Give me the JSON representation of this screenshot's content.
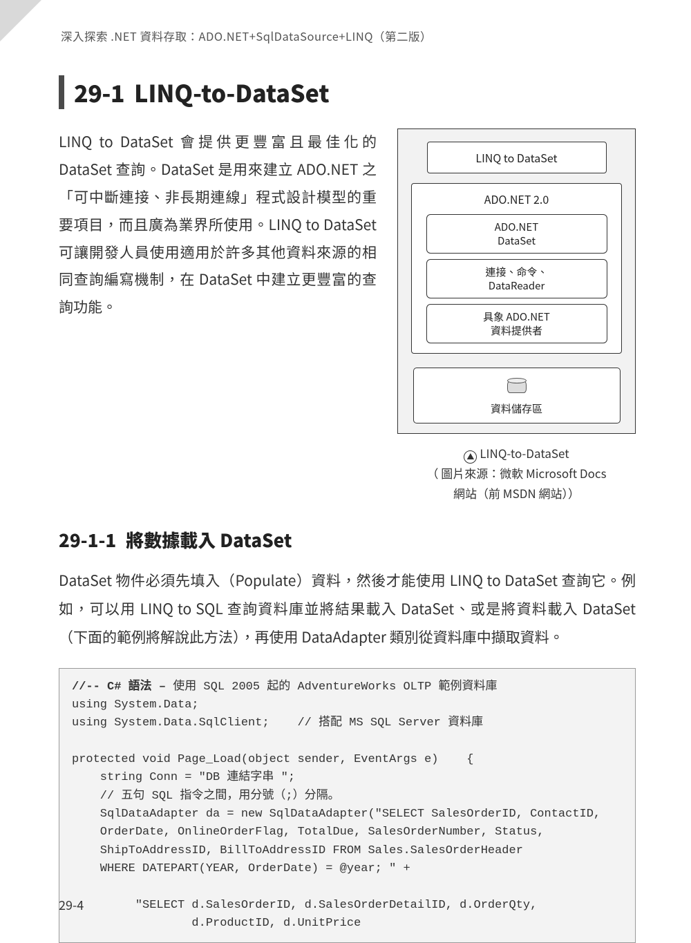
{
  "running_head": "深入探索 .NET 資料存取：ADO.NET+SqlDataSource+LINQ（第二版）",
  "section": {
    "num": "29-1",
    "title": "LINQ-to-DataSet"
  },
  "intro": "LINQ to DataSet 會提供更豐富且最佳化的 DataSet 查詢。DataSet 是用來建立 ADO.NET 之「可中斷連接、非長期連線」程式設計模型的重要項目，而且廣為業界所使用。LINQ to DataSet 可讓開發人員使用適用於許多其他資料來源的相同查詢編寫機制，在 DataSet 中建立更豐富的查詢功能。",
  "diagram": {
    "linq": "LINQ to DataSet",
    "ado_title": "ADO.NET 2.0",
    "inner1a": "ADO.NET",
    "inner1b": "DataSet",
    "inner2a": "連接、命令、",
    "inner2b": "DataReader",
    "inner3a": "具象 ADO.NET",
    "inner3b": "資料提供者",
    "storage": "資料儲存區"
  },
  "caption": {
    "line1": "LINQ-to-DataSet",
    "line2": "（ 圖片來源：微軟 Microsoft Docs",
    "line3": "網站（前 MSDN 網站））"
  },
  "subsection": {
    "num": "29-1-1",
    "title": "將數據載入 DataSet"
  },
  "body": "DataSet 物件必須先填入（Populate）資料，然後才能使用 LINQ to DataSet 查詢它。例如，可以用 LINQ to SQL 查詢資料庫並將結果載入 DataSet、或是將資料載入 DataSet（下面的範例將解說此方法），再使用 DataAdapter 類別從資料庫中擷取資料。",
  "code": {
    "l01a": "//-- C# 語法 –",
    "l01b": " 使用 SQL 2005 起的 AdventureWorks OLTP 範例資料庫",
    "l02": "using System.Data;",
    "l03": "using System.Data.SqlClient;    // 搭配 MS SQL Server 資料庫",
    "l04": "",
    "l05": "protected void Page_Load(object sender, EventArgs e)    {",
    "l06": "    string Conn = \"DB 連結字串 \";",
    "l07": "    // 五句 SQL 指令之間，用分號（;）分隔。",
    "l08": "    SqlDataAdapter da = new SqlDataAdapter(\"SELECT SalesOrderID, ContactID,",
    "l09": "    OrderDate, OnlineOrderFlag, TotalDue, SalesOrderNumber, Status,",
    "l10": "    ShipToAddressID, BillToAddressID FROM Sales.SalesOrderHeader",
    "l11": "    WHERE DATEPART(YEAR, OrderDate) = @year; \" +",
    "l12": "",
    "l13": "         \"SELECT d.SalesOrderID, d.SalesOrderDetailID, d.OrderQty,",
    "l14": "                 d.ProductID, d.UnitPrice"
  },
  "page_number": "29-4"
}
